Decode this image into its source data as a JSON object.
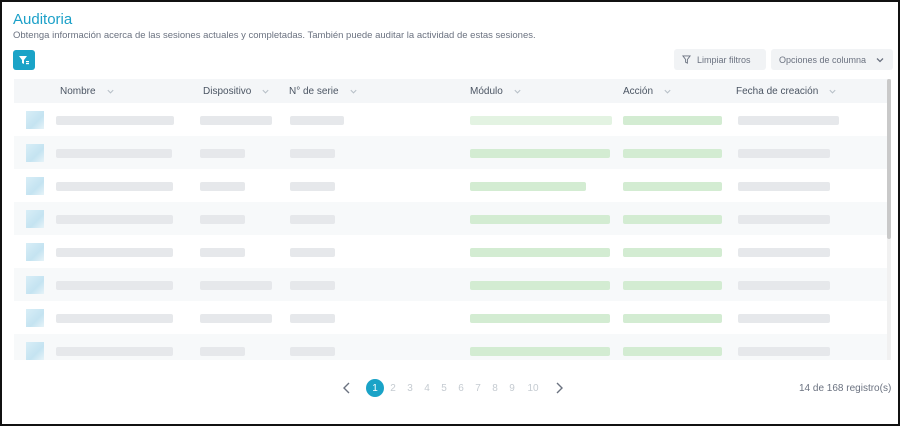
{
  "page": {
    "title": "Auditoria",
    "subtitle": "Obtenga información acerca de las sesiones actuales y completadas. También puede auditar la actividad de estas sesiones."
  },
  "toolbar": {
    "filter_icon": "filter-icon",
    "clear_filters_label": "Limpiar filtros",
    "column_options_label": "Opciones de columna"
  },
  "table": {
    "columns": [
      "Nombre",
      "Dispositivo",
      "N° de serie",
      "Módulo",
      "Acción",
      "Fecha de creación"
    ],
    "row_count_visible": 8
  },
  "pagination": {
    "pages": [
      "1",
      "2",
      "3",
      "4",
      "5",
      "6",
      "7",
      "8",
      "9",
      "10"
    ],
    "current": "1",
    "records_label": "14 de 168 registro(s)"
  },
  "colors": {
    "accent": "#1aa3c7",
    "title": "#1ba0c8"
  }
}
